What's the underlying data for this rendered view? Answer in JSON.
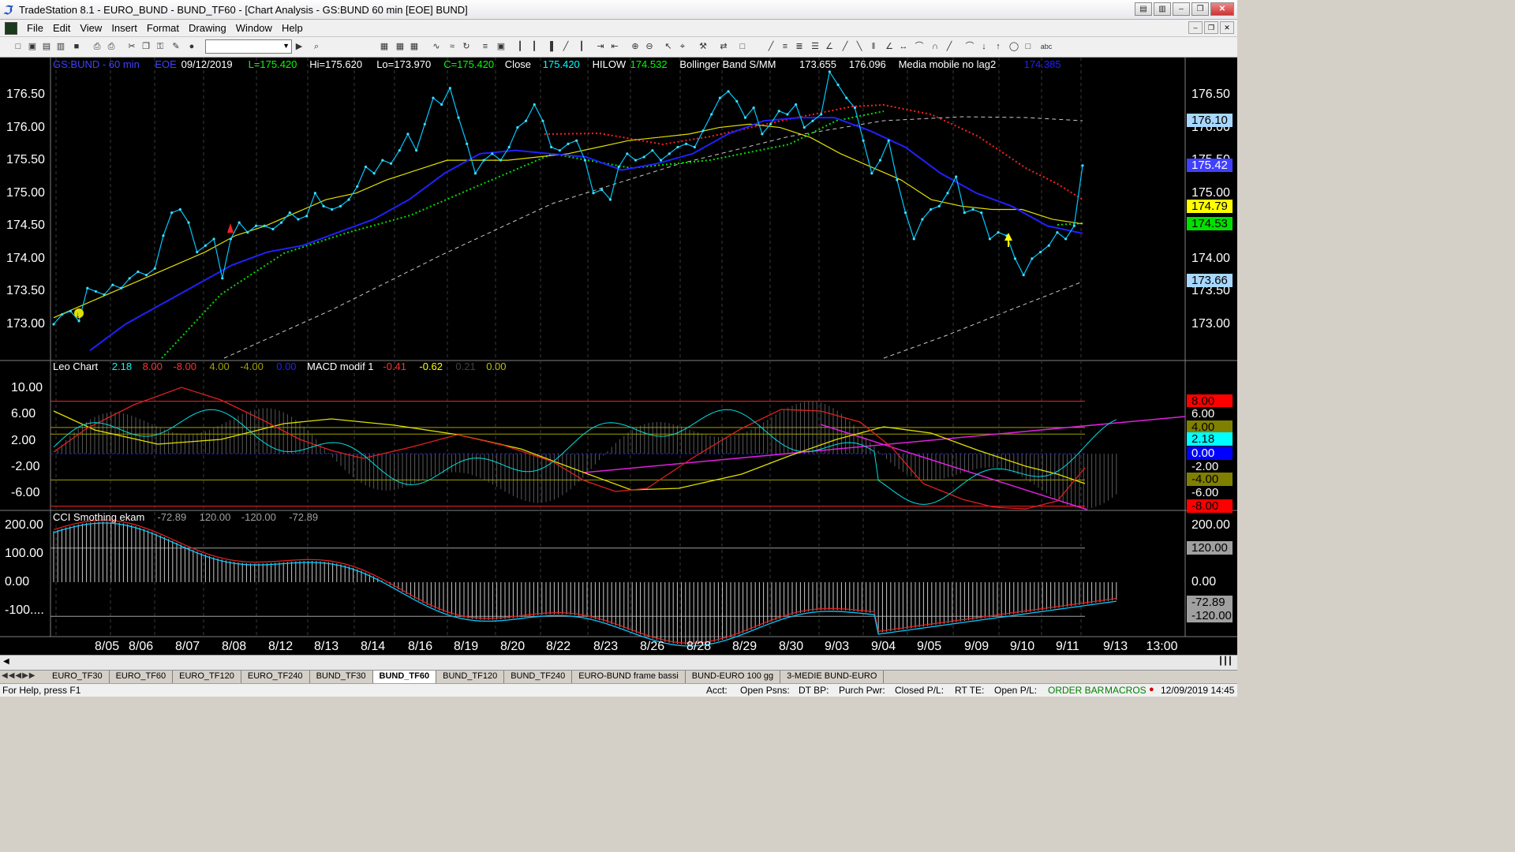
{
  "window": {
    "title": "TradeStation 8.1 - EURO_BUND - BUND_TF60 - [Chart Analysis - GS:BUND  60 min  [EOE] BUND]"
  },
  "menu": [
    "File",
    "Edit",
    "View",
    "Insert",
    "Format",
    "Drawing",
    "Window",
    "Help"
  ],
  "toolbar": {
    "symbol_value": ""
  },
  "price_panel": {
    "header": [
      {
        "text": "GS:BUND - 60 min",
        "color": "#4040ff"
      },
      {
        "text": "EOE",
        "color": "#4040ff"
      },
      {
        "text": "09/12/2019",
        "color": "#ffffff"
      },
      {
        "text": "L=175.420",
        "color": "#00ff00"
      },
      {
        "text": "Hi=175.620",
        "color": "#ffffff"
      },
      {
        "text": "Lo=173.970",
        "color": "#ffffff"
      },
      {
        "text": "C=175.420",
        "color": "#00ff00"
      },
      {
        "text": "Close",
        "color": "#ffffff"
      },
      {
        "text": "175.420",
        "color": "#00ffff"
      },
      {
        "text": "HILOW",
        "color": "#ffffff"
      },
      {
        "text": "174.532",
        "color": "#00ff00"
      },
      {
        "text": "Bollinger Band S/MM",
        "color": "#ffffff"
      },
      {
        "text": "173.655",
        "color": "#ffffff"
      },
      {
        "text": "176.096",
        "color": "#ffffff"
      },
      {
        "text": "Media mobile no lag2",
        "color": "#ffffff"
      },
      {
        "text": "174.385",
        "color": "#2020ff"
      }
    ],
    "y_ticks": [
      "176.50",
      "176.00",
      "175.50",
      "175.00",
      "174.50",
      "174.00",
      "173.50",
      "173.00"
    ],
    "badges": [
      {
        "text": "176.10",
        "bg": "#a8d8ff",
        "fg": "#000000",
        "value": 176.1
      },
      {
        "text": "175.42",
        "bg": "#4040ff",
        "fg": "#ffffff",
        "value": 175.42
      },
      {
        "text": "174.79",
        "bg": "#ffff00",
        "fg": "#000000",
        "value": 174.79
      },
      {
        "text": "174.53",
        "bg": "#00e000",
        "fg": "#000000",
        "value": 174.53
      },
      {
        "text": "173.66",
        "bg": "#a8d8ff",
        "fg": "#000000",
        "value": 173.66
      }
    ]
  },
  "macd_panel": {
    "header": [
      {
        "text": "Leo Chart",
        "color": "#ffffff"
      },
      {
        "text": "2.18",
        "color": "#00ffff"
      },
      {
        "text": "8.00",
        "color": "#ff3030"
      },
      {
        "text": "-8.00",
        "color": "#ff3030"
      },
      {
        "text": "4.00",
        "color": "#a0a000"
      },
      {
        "text": "-4.00",
        "color": "#a0a000"
      },
      {
        "text": "0.00",
        "color": "#2020ff"
      },
      {
        "text": "MACD modif 1",
        "color": "#ffffff"
      },
      {
        "text": "-0.41",
        "color": "#ff3030"
      },
      {
        "text": "-0.62",
        "color": "#ffff00"
      },
      {
        "text": "0.21",
        "color": "#404040"
      },
      {
        "text": "0.00",
        "color": "#c0c000"
      }
    ],
    "y_ticks": [
      "10.00",
      "6.00",
      "2.00",
      "-2.00",
      "-6.00"
    ],
    "badges": [
      {
        "text": "8.00",
        "bg": "#ff0000",
        "fg": "#000000",
        "value": 8
      },
      {
        "text": "6.00",
        "bg": "#000000",
        "fg": "#ffffff",
        "value": 6
      },
      {
        "text": "4.00",
        "bg": "#808000",
        "fg": "#000000",
        "value": 4
      },
      {
        "text": "2.18",
        "bg": "#00ffff",
        "fg": "#000000",
        "value": 2.18
      },
      {
        "text": "0.00",
        "bg": "#0000ff",
        "fg": "#ffffff",
        "value": 0
      },
      {
        "text": "-2.00",
        "bg": "#000000",
        "fg": "#ffffff",
        "value": -2
      },
      {
        "text": "-4.00",
        "bg": "#808000",
        "fg": "#000000",
        "value": -4
      },
      {
        "text": "-6.00",
        "bg": "#000000",
        "fg": "#ffffff",
        "value": -6
      },
      {
        "text": "-8.00",
        "bg": "#ff0000",
        "fg": "#000000",
        "value": -8
      }
    ]
  },
  "cci_panel": {
    "header": [
      {
        "text": "CCI Smothing ekam",
        "color": "#ffffff"
      },
      {
        "text": "-72.89",
        "color": "#a0a0a0"
      },
      {
        "text": "120.00",
        "color": "#a0a0a0"
      },
      {
        "text": "-120.00",
        "color": "#a0a0a0"
      },
      {
        "text": "-72.89",
        "color": "#a0a0a0"
      }
    ],
    "y_ticks": [
      "200.00",
      "100.00",
      "0.00",
      "-100...."
    ],
    "badges": [
      {
        "text": "120.00",
        "bg": "#a0a0a0",
        "fg": "#000000",
        "value": 120
      },
      {
        "text": "-72.89",
        "bg": "#a0a0a0",
        "fg": "#000000",
        "value": -72.89
      },
      {
        "text": "-120.00",
        "bg": "#a0a0a0",
        "fg": "#000000",
        "value": -120
      }
    ]
  },
  "x_ticks": [
    "8/05",
    "8/06",
    "8/07",
    "8/08",
    "8/12",
    "8/13",
    "8/14",
    "8/16",
    "8/19",
    "8/20",
    "8/22",
    "8/23",
    "8/26",
    "8/28",
    "8/29",
    "8/30",
    "9/03",
    "9/04",
    "9/05",
    "9/09",
    "9/10",
    "9/11",
    "9/13",
    "13:00"
  ],
  "tabs": [
    "EURO_TF30",
    "EURO_TF60",
    "EURO_TF120",
    "EURO_TF240",
    "BUND_TF30",
    "BUND_TF60",
    "BUND_TF120",
    "BUND_TF240",
    "EURO-BUND frame bassi",
    "BUND-EURO 100 gg",
    "3-MEDIE BUND-EURO"
  ],
  "active_tab": "BUND_TF60",
  "status": {
    "help": "For Help, press F1",
    "acct": "Acct:",
    "open_psns": "Open Psns:",
    "dt_bp": "DT BP:",
    "purch_pwr": "Purch Pwr:",
    "closed_pl": "Closed P/L:",
    "rt_te": "RT TE:",
    "open_pl": "Open P/L:",
    "order_bar": "ORDER BAR",
    "macros": "MACROS",
    "datetime": "12/09/2019 14:45"
  },
  "chart_data": {
    "type": "line",
    "price": [
      173.0,
      173.15,
      173.2,
      173.05,
      173.55,
      173.5,
      173.45,
      173.6,
      173.55,
      173.7,
      173.8,
      173.75,
      173.85,
      174.35,
      174.7,
      174.75,
      174.55,
      174.1,
      174.2,
      174.3,
      173.7,
      174.3,
      174.55,
      174.4,
      174.5,
      174.5,
      174.45,
      174.55,
      174.7,
      174.6,
      174.65,
      175.0,
      174.8,
      174.75,
      174.8,
      174.9,
      175.1,
      175.4,
      175.3,
      175.5,
      175.45,
      175.65,
      175.9,
      175.65,
      176.05,
      176.45,
      176.35,
      176.6,
      176.15,
      175.75,
      175.3,
      175.5,
      175.6,
      175.5,
      175.7,
      176.0,
      176.1,
      176.35,
      176.1,
      175.7,
      175.65,
      175.75,
      175.8,
      175.5,
      175.0,
      175.05,
      174.9,
      175.4,
      175.6,
      175.5,
      175.55,
      175.65,
      175.5,
      175.6,
      175.7,
      175.75,
      175.7,
      175.95,
      176.2,
      176.45,
      176.55,
      176.4,
      176.15,
      176.3,
      175.9,
      176.05,
      176.25,
      176.2,
      176.35,
      176.0,
      176.1,
      176.2,
      176.85,
      176.65,
      176.45,
      176.3,
      175.8,
      175.3,
      175.5,
      175.8,
      175.2,
      174.7,
      174.3,
      174.6,
      174.75,
      174.8,
      175.0,
      175.25,
      174.7,
      174.75,
      174.7,
      174.3,
      174.4,
      174.35,
      174.0,
      173.75,
      174.0,
      174.1,
      174.2,
      174.4,
      174.3,
      174.5,
      175.42
    ],
    "sma_fast": [
      173.1,
      173.3,
      173.5,
      173.7,
      173.9,
      174.1,
      174.35,
      174.5,
      174.7,
      174.9,
      175.0,
      175.2,
      175.35,
      175.5,
      175.5,
      175.5,
      175.55,
      175.6,
      175.7,
      175.8,
      175.85,
      175.9,
      176.0,
      176.05,
      176.0,
      175.85,
      175.6,
      175.4,
      175.2,
      174.9,
      174.8,
      174.75,
      174.75,
      174.6,
      174.53
    ],
    "ma_blue": [
      172.6,
      173.0,
      173.3,
      173.6,
      173.9,
      174.1,
      174.2,
      174.4,
      174.6,
      174.9,
      175.3,
      175.6,
      175.65,
      175.6,
      175.55,
      175.35,
      175.45,
      175.6,
      175.9,
      176.1,
      176.15,
      176.15,
      175.95,
      175.7,
      175.3,
      175.0,
      174.8,
      174.5,
      174.385
    ],
    "x": [
      "8/05",
      "8/06",
      "8/07",
      "8/08",
      "8/12",
      "8/13",
      "8/14",
      "8/16",
      "8/19",
      "8/20",
      "8/22",
      "8/23",
      "8/26",
      "8/28",
      "8/29",
      "8/30",
      "9/03",
      "9/04",
      "9/05",
      "9/09",
      "9/10",
      "9/11"
    ],
    "ylim": [
      172.5,
      176.9
    ]
  }
}
